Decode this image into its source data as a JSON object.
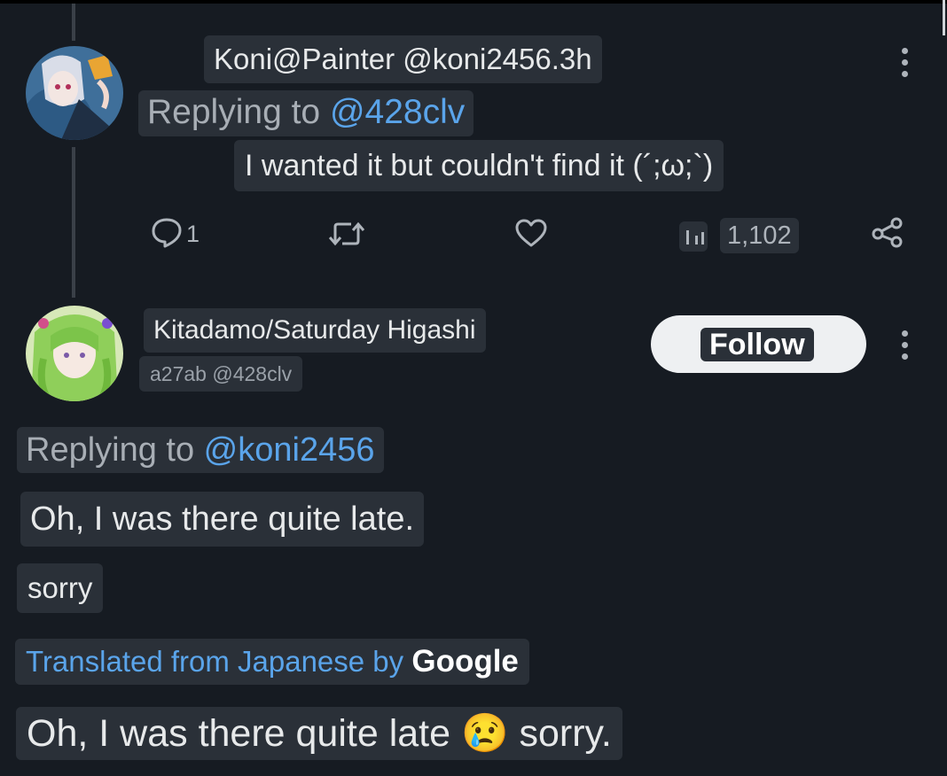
{
  "reply_tweet": {
    "author_line": "Koni@Painter @koni2456.3h",
    "replying_prefix": "Replying to ",
    "replying_handle": "@428clv",
    "text": "I wanted it but couldn't find it (´;ω;`)",
    "actions": {
      "reply_count": "1",
      "views_count": "1,102"
    }
  },
  "main_tweet": {
    "display_name": "Kitadamo/Saturday Higashi",
    "handle_line": "a27ab @428clv",
    "follow_label": "Follow",
    "replying_prefix": "Replying to ",
    "replying_handle": "@koni2456",
    "text_line1": "Oh, I was there quite late.",
    "text_line2": "sorry",
    "translation": {
      "note": "Translated from Japanese by ",
      "provider": "Google"
    },
    "translated_text": "Oh, I was there quite late",
    "translated_emoji": "😢",
    "translated_text_end": " sorry."
  },
  "colors": {
    "background": "#161b22",
    "chip": "#2a3038",
    "link": "#5aa4ea",
    "text": "#e7e9ea",
    "icon": "#aeb4bb"
  },
  "icons": [
    "kebab-menu-icon",
    "reply-icon",
    "retweet-icon",
    "like-icon",
    "views-icon",
    "share-icon"
  ]
}
